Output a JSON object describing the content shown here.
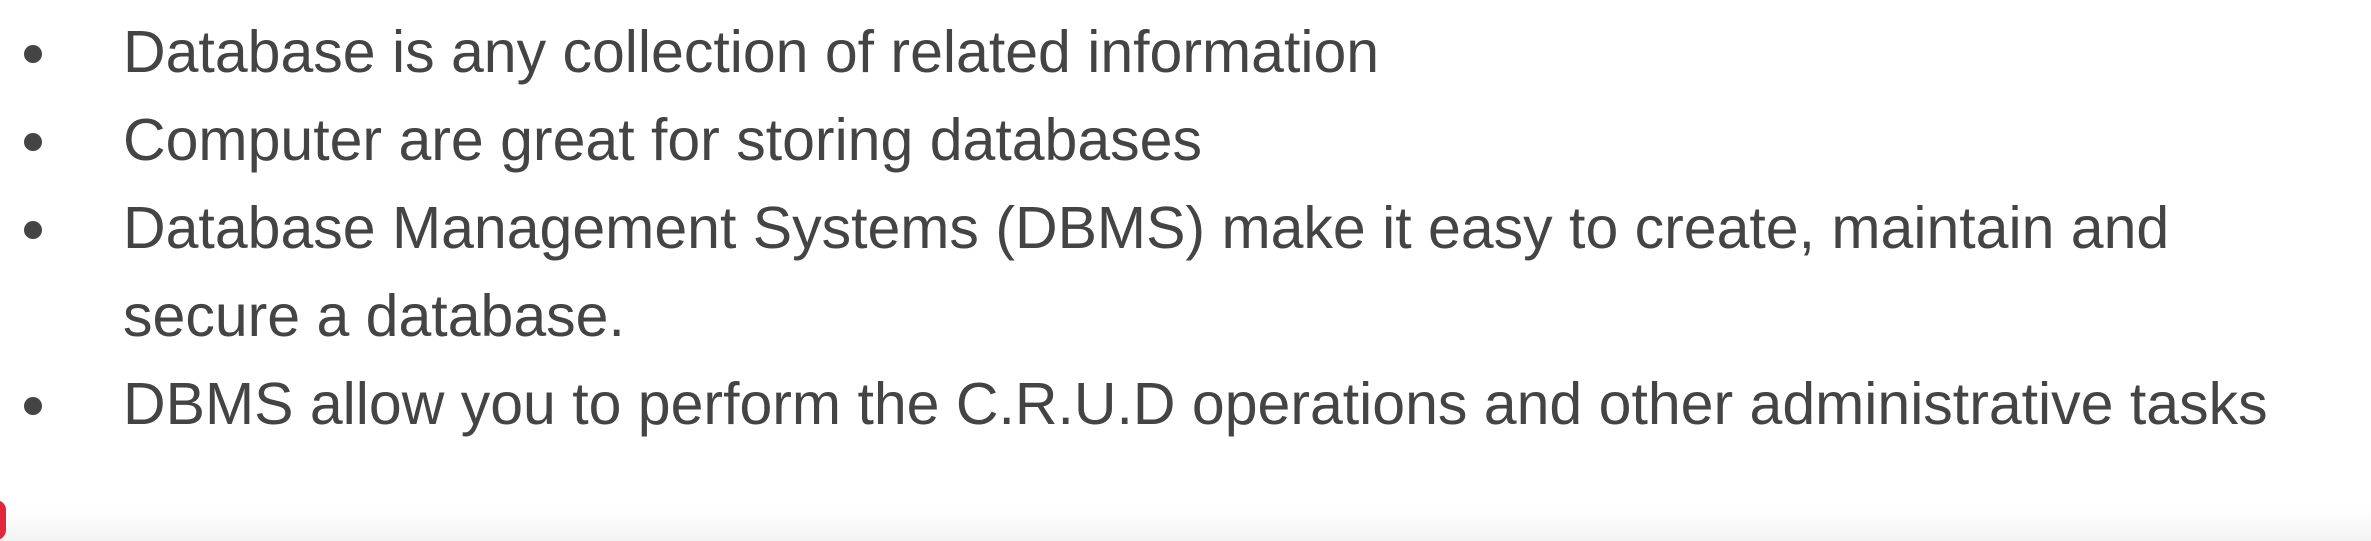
{
  "bullets": [
    {
      "text": "Database is any collection of related information"
    },
    {
      "text": "Computer are great for storing databases"
    },
    {
      "text": "Database Management Systems (DBMS) make it easy to create, maintain and secure a database."
    },
    {
      "text": "DBMS allow you to perform the C.R.U.D operations and other administrative tasks"
    }
  ],
  "colors": {
    "text": "#444444",
    "background": "#ffffff",
    "edge_mark": "#e0283c"
  }
}
